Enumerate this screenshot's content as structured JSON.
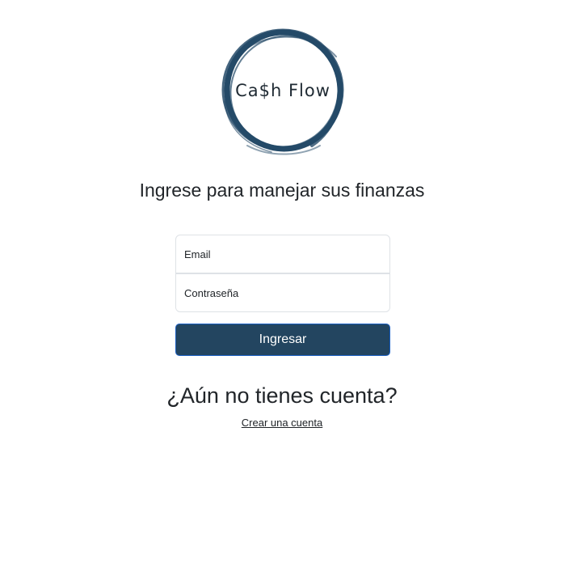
{
  "logo": {
    "text": "Ca$h Flow",
    "ring_color": "#244a68"
  },
  "heading": "Ingrese para manejar sus finanzas",
  "form": {
    "email_placeholder": "Email",
    "password_placeholder": "Contraseña",
    "submit_label": "Ingresar"
  },
  "signup": {
    "question": "¿Aún no tienes cuenta?",
    "link_label": "Crear una cuenta"
  },
  "colors": {
    "button_bg": "#234560",
    "button_border": "#1a5fc2"
  }
}
